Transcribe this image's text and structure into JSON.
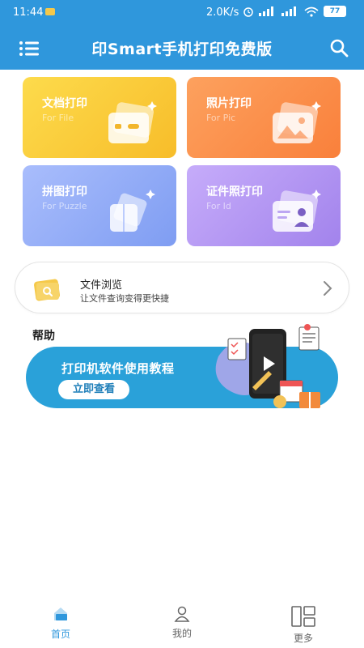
{
  "status": {
    "time": "11:44",
    "speed": "2.0K/s",
    "battery": "77"
  },
  "app": {
    "title": "印Smart手机打印免费版"
  },
  "cards": [
    {
      "title": "文档打印",
      "subtitle": "For File"
    },
    {
      "title": "照片打印",
      "subtitle": "For Pic"
    },
    {
      "title": "拼图打印",
      "subtitle": "For Puzzle"
    },
    {
      "title": "证件照打印",
      "subtitle": "For Id"
    }
  ],
  "browse": {
    "title": "文件浏览",
    "subtitle": "让文件查询变得更快捷"
  },
  "help": {
    "title": "帮助",
    "banner_text": "打印机软件使用教程",
    "banner_button": "立即查看"
  },
  "nav": {
    "home": "首页",
    "mine": "我的",
    "more": "更多"
  },
  "colors": {
    "primary": "#2f97dc",
    "card_file": "#f7bd2a",
    "card_pic": "#f9803b",
    "card_puzzle": "#7f9df2",
    "card_id": "#a283ec"
  }
}
